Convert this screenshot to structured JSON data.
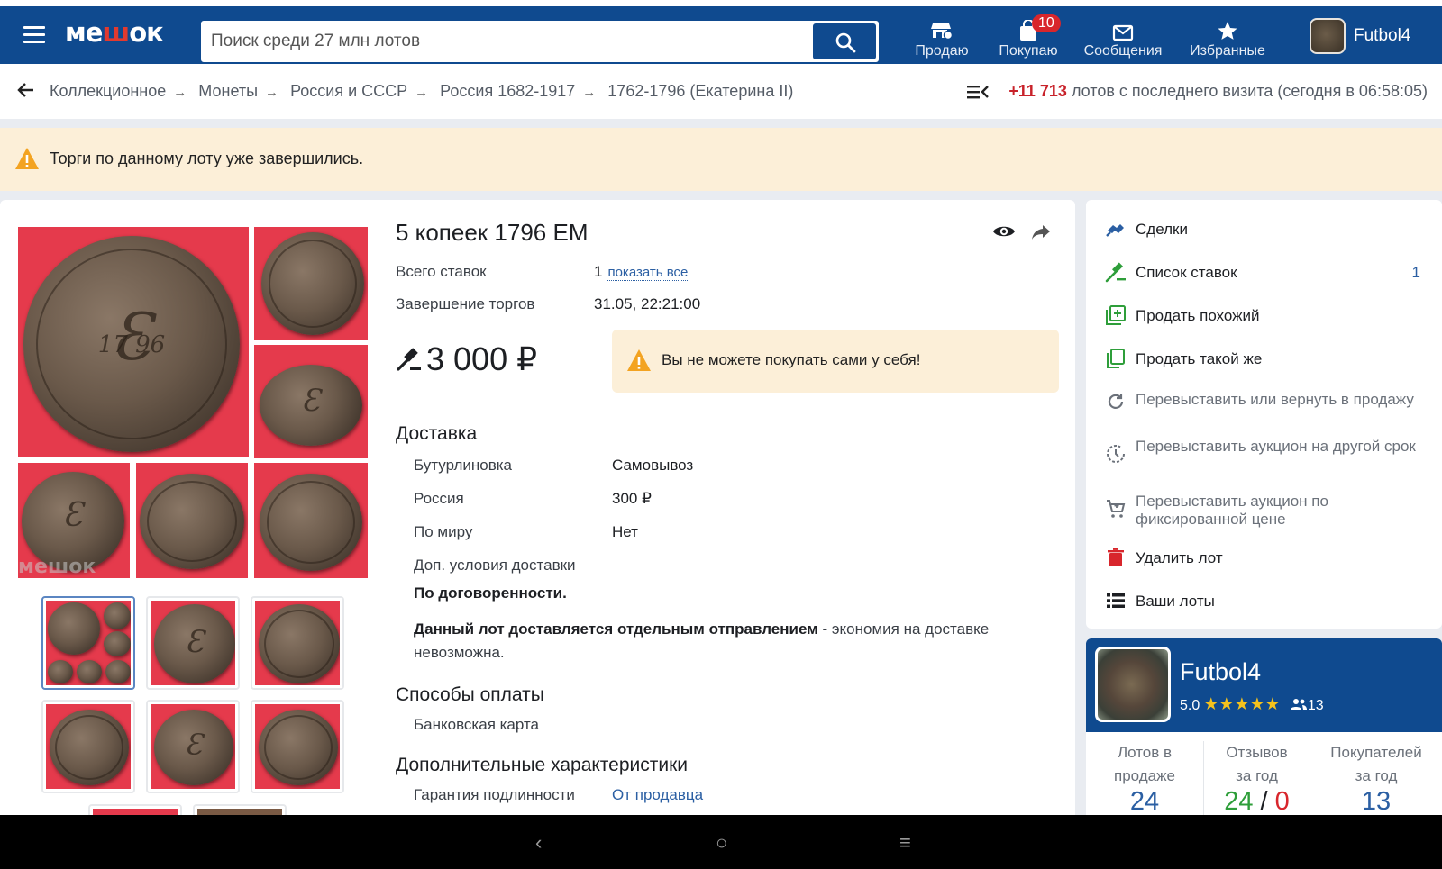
{
  "header": {
    "logo": {
      "pre": "ме",
      "accent": "ш",
      "post": "ок"
    },
    "search": {
      "placeholder": "Поиск среди 27 млн лотов",
      "value": ""
    },
    "nav": [
      {
        "label": "Продаю",
        "icon": "store-icon"
      },
      {
        "label": "Покупаю",
        "icon": "shopping-bag-icon",
        "badge": "10"
      },
      {
        "label": "Сообщения",
        "icon": "envelope-icon"
      },
      {
        "label": "Избранные",
        "icon": "star-icon"
      }
    ],
    "user": {
      "name": "Futbol4"
    }
  },
  "breadcrumb": {
    "items": [
      "Коллекционное",
      "Монеты",
      "Россия и СССР",
      "Россия 1682-1917",
      "1762-1796 (Екатерина II)"
    ],
    "separator": "→"
  },
  "visit": {
    "count": "+11 713",
    "text": "лотов с последнего визита (сегодня в 06:58:05)"
  },
  "alert": {
    "text": "Торги по данному лоту уже завершились."
  },
  "lot": {
    "title": "5 копеек 1796 ЕМ",
    "bids_label": "Всего ставок",
    "bids_value": "1",
    "bids_link": "показать все",
    "end_label": "Завершение торгов",
    "end_value": "31.05, 22:21:00",
    "price": "3 000 ₽",
    "notice": "Вы не можете покупать сами у себя!"
  },
  "gallery": {
    "watermark": "мешок",
    "thumbs_count": 6
  },
  "delivery": {
    "title": "Доставка",
    "rows": [
      {
        "label": "Бутурлиновка",
        "value": "Самовывоз"
      },
      {
        "label": "Россия",
        "value": "300 ₽"
      },
      {
        "label": "По миру",
        "value": "Нет"
      }
    ],
    "extra_label": "Доп. условия доставки",
    "extra_value": "По договоренности.",
    "note_bold": "Данный лот доставляется отдельным отправлением",
    "note_rest": " - экономия на доставке невозможна."
  },
  "payment": {
    "title": "Способы оплаты",
    "value": "Банковская карта"
  },
  "extra": {
    "title": "Дополнительные характеристики",
    "label": "Гарантия подлинности",
    "value": "От продавца"
  },
  "side_menu": [
    {
      "label": "Сделки",
      "icon": "handshake-icon"
    },
    {
      "label": "Список ставок",
      "icon": "gavel-icon",
      "count": "1"
    },
    {
      "label": "Продать похожий",
      "icon": "add-copy-icon"
    },
    {
      "label": "Продать такой же",
      "icon": "copy-icon"
    },
    {
      "label": "Перевыставить или вернуть в продажу",
      "icon": "refresh-icon"
    },
    {
      "label": "Перевыставить аукцион на другой срок",
      "icon": "clock-icon"
    },
    {
      "label": "Перевыставить аукцион по фиксированной цене",
      "icon": "cart-icon"
    },
    {
      "label": "Удалить лот",
      "icon": "trash-icon"
    },
    {
      "label": "Ваши лоты",
      "icon": "list-icon"
    }
  ],
  "seller": {
    "name": "Futbol4",
    "rating": "5.0",
    "stars": "★★★★★",
    "followers": "13",
    "stats": [
      {
        "label1": "Лотов в",
        "label2": "продаже",
        "value": "24"
      },
      {
        "label1": "Отзывов",
        "label2": "за год",
        "pos": "24",
        "slash": "/",
        "neg": "0"
      },
      {
        "label1": "Покупателей",
        "label2": "за год",
        "value": "13"
      }
    ]
  },
  "system_nav": {
    "back": "‹",
    "home": "○",
    "menu": "≡"
  },
  "colors": {
    "brand": "#0f4a8f",
    "accent_red": "#c8222a",
    "warn_bg": "#fcefd8",
    "link": "#2b5fa3",
    "green": "#2e9e3a"
  }
}
